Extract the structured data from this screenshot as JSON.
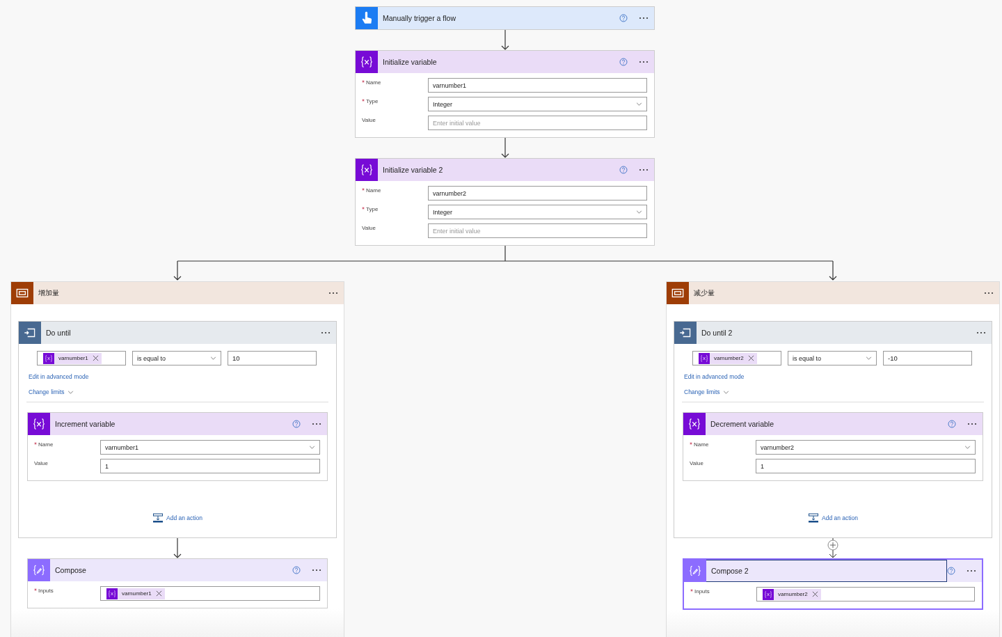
{
  "trigger": {
    "title": "Manually trigger a flow"
  },
  "init_variables": [
    {
      "title": "Initialize variable",
      "fields": [
        {
          "label": "Name",
          "required": true,
          "kind": "text",
          "value": "varnumber1"
        },
        {
          "label": "Type",
          "required": true,
          "kind": "dropdown",
          "value": "Integer"
        },
        {
          "label": "Value",
          "required": false,
          "kind": "text",
          "placeholder": "Enter initial value"
        }
      ]
    },
    {
      "title": "Initialize variable 2",
      "fields": [
        {
          "label": "Name",
          "required": true,
          "kind": "text",
          "value": "varnumber2"
        },
        {
          "label": "Type",
          "required": true,
          "kind": "dropdown",
          "value": "Integer"
        },
        {
          "label": "Value",
          "required": false,
          "kind": "text",
          "placeholder": "Enter initial value"
        }
      ]
    }
  ],
  "branches": [
    {
      "title": "增加量",
      "do_until": {
        "title": "Do until",
        "condition": {
          "token": "varnumber1",
          "operator": "is equal to",
          "value": "10"
        },
        "advanced_link": "Edit in advanced mode",
        "limits_link": "Change limits",
        "action": {
          "title": "Increment variable",
          "fields": [
            {
              "label": "Name",
              "required": true,
              "kind": "dropdown",
              "value": "varnumber1"
            },
            {
              "label": "Value",
              "required": false,
              "kind": "text",
              "value": "1"
            }
          ]
        },
        "add_action": "Add an action"
      },
      "insert_button": false,
      "compose": {
        "title": "Compose",
        "selected": false,
        "fields": [
          {
            "label": "Inputs",
            "required": true,
            "kind": "token",
            "value": "varnumber1"
          }
        ]
      }
    },
    {
      "title": "减少量",
      "do_until": {
        "title": "Do until 2",
        "condition": {
          "token": "varnumber2",
          "operator": "is equal to",
          "value": "-10"
        },
        "advanced_link": "Edit in advanced mode",
        "limits_link": "Change limits",
        "action": {
          "title": "Decrement variable",
          "fields": [
            {
              "label": "Name",
              "required": true,
              "kind": "dropdown",
              "value": "varnumber2"
            },
            {
              "label": "Value",
              "required": false,
              "kind": "text",
              "value": "1"
            }
          ]
        },
        "add_action": "Add an action"
      },
      "insert_button": true,
      "compose": {
        "title": "Compose 2",
        "selected": true,
        "fields": [
          {
            "label": "Inputs",
            "required": true,
            "kind": "token",
            "value": "varnumber2"
          }
        ]
      }
    }
  ]
}
